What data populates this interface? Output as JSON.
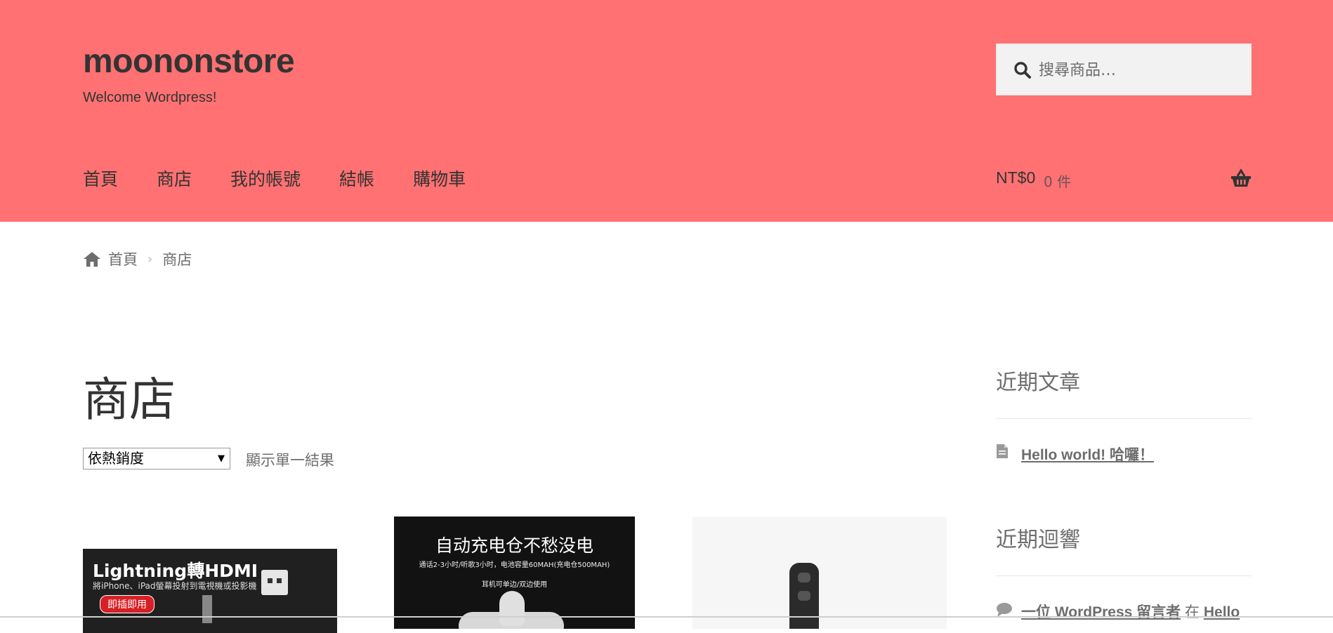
{
  "site": {
    "title": "moononstore",
    "tagline": "Welcome Wordpress!"
  },
  "search": {
    "placeholder": "搜尋商品…"
  },
  "nav": {
    "items": [
      "首頁",
      "商店",
      "我的帳號",
      "結帳",
      "購物車"
    ]
  },
  "cart": {
    "amount": "NT$0",
    "count": "0 件"
  },
  "breadcrumb": {
    "home": "首頁",
    "sep": "›",
    "current": "商店"
  },
  "page": {
    "title": "商店"
  },
  "ordering": {
    "selected": "依熱銷度",
    "arrow": "▼"
  },
  "result_count": "顯示單一結果",
  "products": [
    {
      "title": "Lightning轉HDMI",
      "subtitle": "將iPhone、iPad螢幕投射到電視機或投影機",
      "badge": "即插即用"
    },
    {
      "title": "自动充电仓不愁没电",
      "subtitle": "通话2-3小时/听歌3小时，电池容量60MAH(充电仓500MAH)",
      "note": "耳机可单边/双边使用"
    },
    {
      "title": ""
    }
  ],
  "widgets": {
    "recent_posts": {
      "title": "近期文章",
      "items": [
        "Hello world! 哈囉！"
      ]
    },
    "recent_comments": {
      "title": "近期迴響",
      "author": "一位 WordPress 留言者",
      "on": "在",
      "post": "Hello"
    }
  },
  "colors": {
    "header_bg": "#ff7172",
    "text": "#333333",
    "muted": "#6d6d6d"
  },
  "icons": [
    "search-icon",
    "cart-basket-icon",
    "home-icon",
    "document-icon",
    "comment-icon"
  ]
}
